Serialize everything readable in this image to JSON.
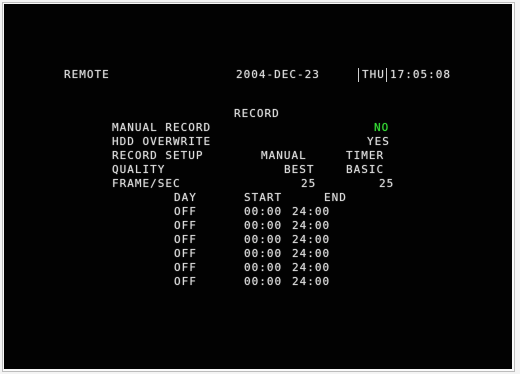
{
  "header": {
    "left_label": "REMOTE",
    "date": "2004-DEC-23",
    "weekday": "THU",
    "time": "17:05:08"
  },
  "menu": {
    "title": "RECORD",
    "manual_record": {
      "label": "MANUAL RECORD",
      "value": "NO",
      "value_color": "#38e038"
    },
    "hdd_overwrite": {
      "label": "HDD OVERWRITE",
      "value": "YES"
    },
    "record_setup": {
      "label": "RECORD SETUP",
      "col1": "MANUAL",
      "col2": "TIMER"
    },
    "quality": {
      "label": "QUALITY",
      "col1": "BEST",
      "col2": "BASIC"
    },
    "frame_sec": {
      "label": "FRAME/SEC",
      "col1": "25",
      "col2": "25"
    }
  },
  "schedule": {
    "headers": {
      "day": "DAY",
      "start": "START",
      "end": "END"
    },
    "rows": [
      {
        "day": "OFF",
        "start": "00:00",
        "end": "24:00"
      },
      {
        "day": "OFF",
        "start": "00:00",
        "end": "24:00"
      },
      {
        "day": "OFF",
        "start": "00:00",
        "end": "24:00"
      },
      {
        "day": "OFF",
        "start": "00:00",
        "end": "24:00"
      },
      {
        "day": "OFF",
        "start": "00:00",
        "end": "24:00"
      },
      {
        "day": "OFF",
        "start": "00:00",
        "end": "24:00"
      }
    ]
  }
}
